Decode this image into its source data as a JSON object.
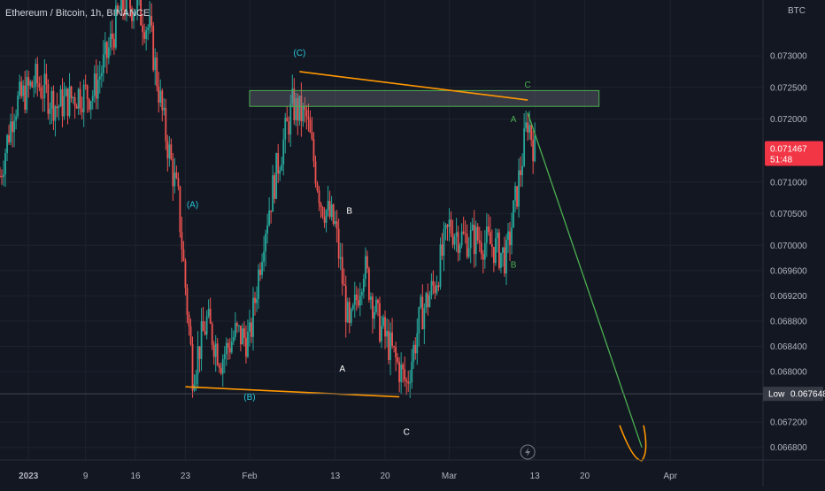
{
  "header": {
    "symbol_title": "Ethereum / Bitcoin, 1h, BINANCE",
    "currency": "BTC"
  },
  "price_tags": {
    "last_price": "0.071467",
    "countdown": "51:48",
    "low_label": "Low",
    "low_price": "0.067648"
  },
  "colors": {
    "background": "#131722",
    "up_candle": "#26a69a",
    "down_candle": "#ef5350",
    "trendline": "#ff9800",
    "target_arrow": "#4caf50",
    "wave_cyan": "#26c6da",
    "wave_green": "#4caf50",
    "wave_white": "#ffffff",
    "last_price_tag": "#f23645",
    "low_tag": "#363a45"
  },
  "icons": {
    "bottom_center": "lightning-icon"
  },
  "chart_data": {
    "type": "candlestick",
    "title": "Ethereum / Bitcoin, 1h, BINANCE",
    "y_axis_unit": "BTC",
    "ylim": [
      0.0666,
      0.0738
    ],
    "y_ticks": [
      "0.073000",
      "0.072500",
      "0.072000",
      "0.071000",
      "0.070500",
      "0.070000",
      "0.069600",
      "0.069200",
      "0.068800",
      "0.068400",
      "0.068000",
      "0.067200",
      "0.066800"
    ],
    "x_ticks": [
      "2023",
      "9",
      "16",
      "23",
      "Feb",
      "13",
      "20",
      "Mar",
      "13",
      "20",
      "Apr"
    ],
    "x_dates": [
      "2023-01-01",
      "2023-01-09",
      "2023-01-16",
      "2023-01-23",
      "2023-02-01",
      "2023-02-13",
      "2023-02-20",
      "2023-03-01",
      "2023-03-13",
      "2023-03-20",
      "2023-04-01"
    ],
    "xlim": [
      "2022-12-28",
      "2023-04-14"
    ],
    "price_path": [
      [
        "2022-12-28",
        0.0711
      ],
      [
        "2022-12-30",
        0.0722
      ],
      [
        "2023-01-02",
        0.0726
      ],
      [
        "2023-01-05",
        0.0722
      ],
      [
        "2023-01-08",
        0.0724
      ],
      [
        "2023-01-10",
        0.0724
      ],
      [
        "2023-01-12",
        0.073
      ],
      [
        "2023-01-14",
        0.0738
      ],
      [
        "2023-01-16",
        0.0738
      ],
      [
        "2023-01-18",
        0.0734
      ],
      [
        "2023-01-20",
        0.0719
      ],
      [
        "2023-01-22",
        0.0707
      ],
      [
        "2023-01-24",
        0.068
      ],
      [
        "2023-01-26",
        0.0688
      ],
      [
        "2023-01-28",
        0.0682
      ],
      [
        "2023-01-30",
        0.0686
      ],
      [
        "2023-02-01",
        0.0685
      ],
      [
        "2023-02-03",
        0.0702
      ],
      [
        "2023-02-05",
        0.0713
      ],
      [
        "2023-02-07",
        0.0722
      ],
      [
        "2023-02-09",
        0.072
      ],
      [
        "2023-02-11",
        0.0707
      ],
      [
        "2023-02-13",
        0.0703
      ],
      [
        "2023-02-15",
        0.0686
      ],
      [
        "2023-02-17",
        0.0697
      ],
      [
        "2023-02-19",
        0.0688
      ],
      [
        "2023-02-21",
        0.0683
      ],
      [
        "2023-02-23",
        0.0678
      ],
      [
        "2023-02-25",
        0.0689
      ],
      [
        "2023-02-27",
        0.0694
      ],
      [
        "2023-03-01",
        0.0703
      ],
      [
        "2023-03-03",
        0.0701
      ],
      [
        "2023-03-05",
        0.0701
      ],
      [
        "2023-03-07",
        0.07
      ],
      [
        "2023-03-09",
        0.0698
      ],
      [
        "2023-03-11",
        0.0712
      ],
      [
        "2023-03-12",
        0.072
      ],
      [
        "2023-03-13",
        0.0715
      ]
    ],
    "annotations": {
      "resistance_zone": {
        "from": "2023-02-01",
        "to": "2023-03-22",
        "low": 0.0722,
        "high": 0.07245
      },
      "upper_trendline": [
        [
          "2023-02-08",
          0.07275
        ],
        [
          "2023-03-12",
          0.0723
        ]
      ],
      "lower_trendline": [
        [
          "2023-01-23",
          0.06776
        ],
        [
          "2023-02-22",
          0.0676
        ]
      ],
      "projection": {
        "from": [
          "2023-03-12",
          0.0721
        ],
        "to": [
          "2023-03-28",
          0.0668
        ]
      },
      "low_line": 0.067648,
      "wave_labels": [
        {
          "text": "(C)",
          "date": "2023-02-08",
          "price": 0.073,
          "style": "cyan"
        },
        {
          "text": "(A)",
          "date": "2023-01-24",
          "price": 0.0706,
          "style": "cyan"
        },
        {
          "text": "(B)",
          "date": "2023-02-01",
          "price": 0.06755,
          "style": "cyan"
        },
        {
          "text": "B",
          "date": "2023-02-15",
          "price": 0.0705,
          "style": "white"
        },
        {
          "text": "A",
          "date": "2023-02-14",
          "price": 0.068,
          "style": "white"
        },
        {
          "text": "C",
          "date": "2023-02-23",
          "price": 0.067,
          "style": "white"
        },
        {
          "text": "A",
          "date": "2023-03-10",
          "price": 0.07195,
          "style": "green"
        },
        {
          "text": "B",
          "date": "2023-03-10",
          "price": 0.06965,
          "style": "green"
        },
        {
          "text": "C",
          "date": "2023-03-12",
          "price": 0.0725,
          "style": "green"
        }
      ]
    }
  }
}
